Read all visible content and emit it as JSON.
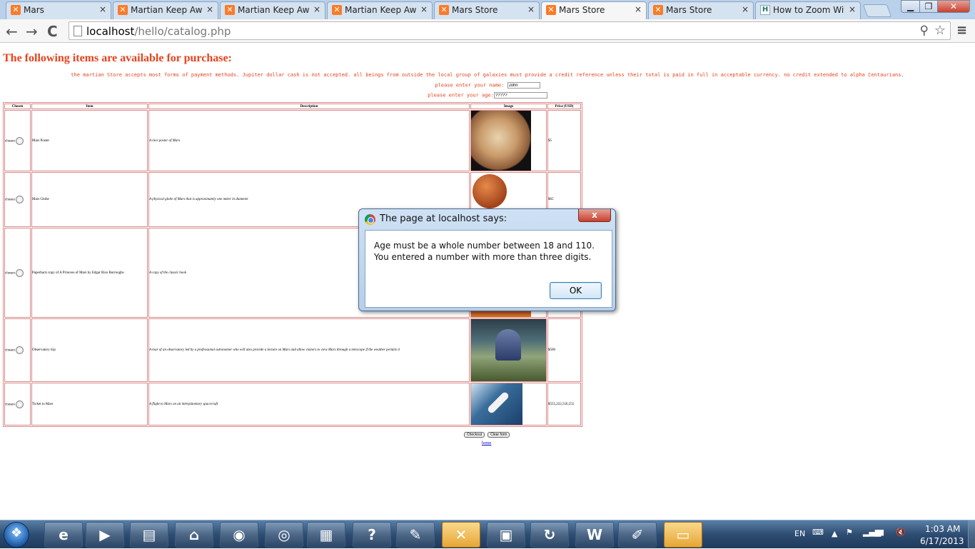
{
  "browser": {
    "tabs": [
      {
        "label": "Mars",
        "favicon": "xampp-icon",
        "active": false
      },
      {
        "label": "Martian Keep Awa",
        "favicon": "xampp-icon",
        "active": false
      },
      {
        "label": "Martian Keep Awa",
        "favicon": "xampp-icon",
        "active": false
      },
      {
        "label": "Martian Keep Awa",
        "favicon": "xampp-icon",
        "active": false
      },
      {
        "label": "Mars Store",
        "favicon": "xampp-icon",
        "active": false
      },
      {
        "label": "Mars Store",
        "favicon": "xampp-icon",
        "active": true
      },
      {
        "label": "Mars Store",
        "favicon": "xampp-icon",
        "active": false
      },
      {
        "label": "How to Zoom Wit",
        "favicon": "wikihow-icon",
        "active": false
      }
    ],
    "close_glyph": "×",
    "url_host": "localhost",
    "url_path": "/hello/catalog.php",
    "back_glyph": "←",
    "forward_glyph": "→",
    "reload_glyph": "C",
    "menu_glyph": "≡"
  },
  "page": {
    "heading": "The following items are available for purchase:",
    "policy": "the martian Store accepts most forms of payment methods. Jupiter dollar cash is not accepted. all beings from outside the local group of galaxies must provide a credit reference unless their total is paid in full in acceptable currency. no credit extended to alpha Centaurians.",
    "name_label": "please enter your name:",
    "name_value": "John",
    "age_label": "please enter your age:",
    "age_value": "?????",
    "table": {
      "headers": [
        "Chosen",
        "Item",
        "Description",
        "Image",
        "Price (USD)"
      ],
      "rows": [
        {
          "chosen_label": "chosen",
          "item": "Mars Poster",
          "description": "A nice poster of Mars",
          "price": "$5"
        },
        {
          "chosen_label": "chosen",
          "item": "Mars Globe",
          "description": "A physical globe of Mars that is approximately one meter in diameter",
          "price": "$65"
        },
        {
          "chosen_label": "chosen",
          "item": "Paperback copy of A Princess of Mars by Edgar Rice Burroughs",
          "description": "A copy of the classic book",
          "price": ""
        },
        {
          "chosen_label": "chosen",
          "item": "Observatory trip",
          "description": "A tour of an observatory led by a professional astronomer who will also provide a lecture on Mars and allow visitors to view Mars through a telescope if the weather permits it",
          "price": "$500"
        },
        {
          "chosen_label": "chosen",
          "item": "Ticket to Mars",
          "description": "A flight to Mars on an interplanetary spacecraft",
          "price": "$555,222,556,555"
        }
      ]
    },
    "checkout_label": "Checkout",
    "clear_label": "Clear form",
    "home_link": "home"
  },
  "dialog": {
    "title": "The page at localhost says:",
    "message": "Age must be a whole number between 18 and 110.  You entered a number with more than three digits.",
    "ok_label": "OK",
    "close_glyph": "x"
  },
  "taskbar": {
    "apps": [
      "internet-explorer-icon",
      "media-player-icon",
      "file-explorer-icon",
      "4g-wimax-icon",
      "firefox-icon",
      "chrome-icon",
      "calculator-icon",
      "help-icon",
      "notepad-icon",
      "xampp-icon",
      "control-panel-icon",
      "sync-icon",
      "word-icon",
      "paint-icon",
      "photo-viewer-icon"
    ],
    "language": "EN",
    "time": "1:03 AM",
    "date": "6/17/2013"
  }
}
